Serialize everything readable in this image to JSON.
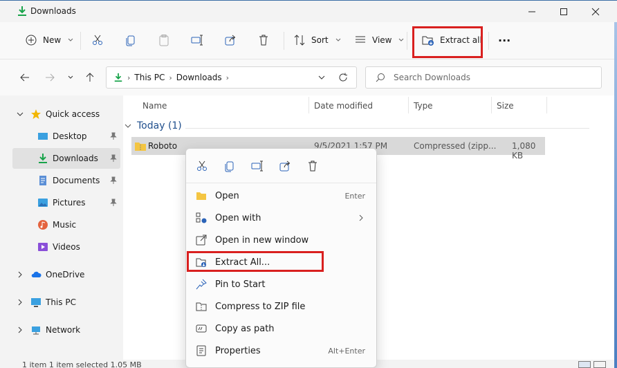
{
  "window": {
    "title": "Downloads"
  },
  "toolbar": {
    "new_label": "New",
    "sort_label": "Sort",
    "view_label": "View",
    "extract_all_label": "Extract all",
    "more_label": "···"
  },
  "address": {
    "crumbs": [
      "This PC",
      "Downloads"
    ],
    "search_placeholder": "Search Downloads"
  },
  "sidebar": {
    "items": [
      {
        "label": "Quick access"
      },
      {
        "label": "Desktop"
      },
      {
        "label": "Downloads"
      },
      {
        "label": "Documents"
      },
      {
        "label": "Pictures"
      },
      {
        "label": "Music"
      },
      {
        "label": "Videos"
      },
      {
        "label": "OneDrive"
      },
      {
        "label": "This PC"
      },
      {
        "label": "Network"
      }
    ]
  },
  "columns": {
    "name": "Name",
    "date": "Date modified",
    "type": "Type",
    "size": "Size"
  },
  "group": {
    "label": "Today (1)"
  },
  "file": {
    "name": "Roboto",
    "date": "9/5/2021 1:57 PM",
    "type": "Compressed (zipp...",
    "size": "1,080 KB"
  },
  "context_menu": {
    "items": [
      {
        "label": "Open",
        "shortcut": "Enter"
      },
      {
        "label": "Open with",
        "shortcut": ""
      },
      {
        "label": "Open in new window",
        "shortcut": ""
      },
      {
        "label": "Extract All...",
        "shortcut": ""
      },
      {
        "label": "Pin to Start",
        "shortcut": ""
      },
      {
        "label": "Compress to ZIP file",
        "shortcut": ""
      },
      {
        "label": "Copy as path",
        "shortcut": ""
      },
      {
        "label": "Properties",
        "shortcut": "Alt+Enter"
      }
    ]
  },
  "status": {
    "text": "1 item    1 item selected  1.05 MB"
  },
  "colors": {
    "accent": "#0067c0",
    "highlight": "#d9201f",
    "folder": "#f4c542",
    "selection": "#d9d9d9"
  },
  "icons": [
    "download-icon",
    "minimize-icon",
    "maximize-icon",
    "close-icon",
    "new-icon",
    "cut-icon",
    "copy-icon",
    "paste-icon",
    "rename-icon",
    "share-icon",
    "delete-icon",
    "sort-icon",
    "view-icon",
    "extract-icon",
    "more-icon"
  ]
}
